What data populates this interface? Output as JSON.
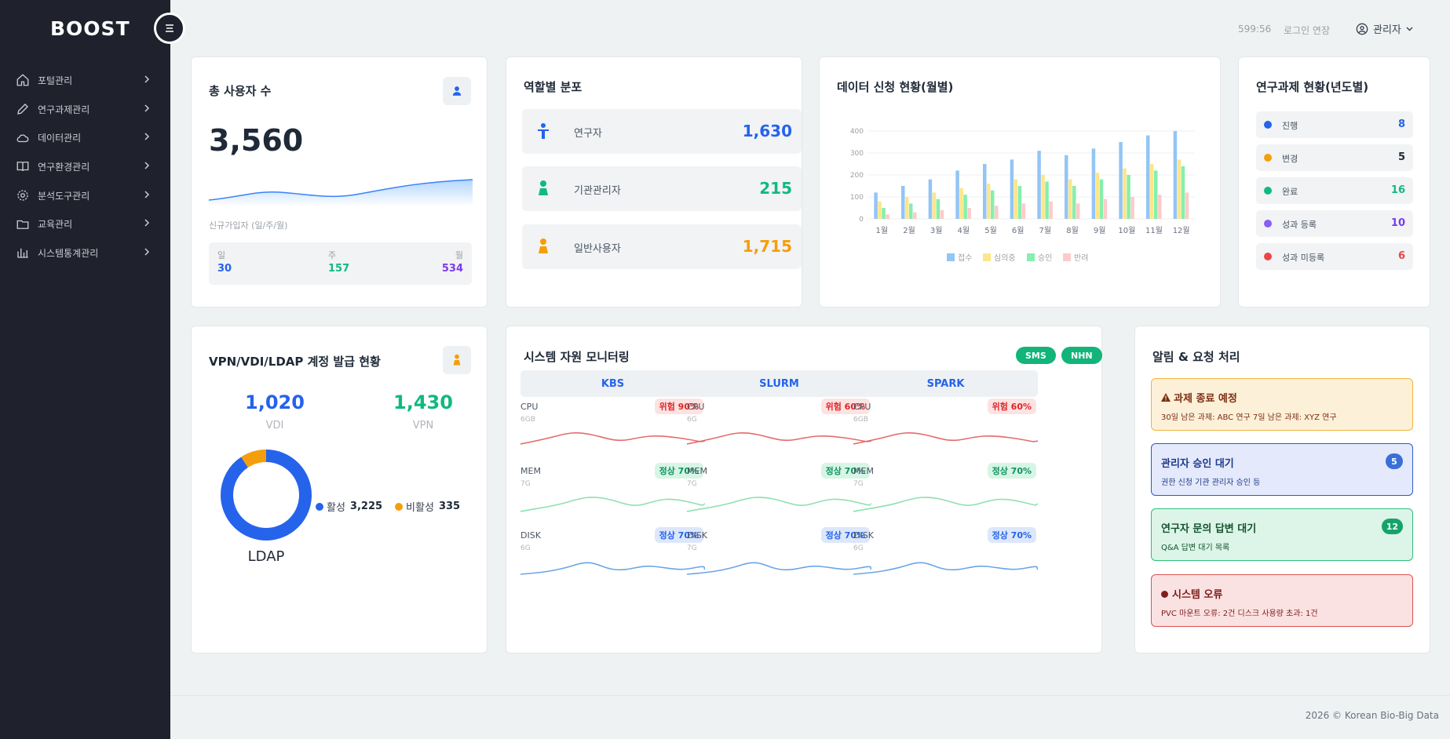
{
  "brand": {
    "logo": "BOOST"
  },
  "sidebar": {
    "items": [
      {
        "label": "포털관리",
        "icon": "home-icon"
      },
      {
        "label": "연구과제관리",
        "icon": "pencil-icon"
      },
      {
        "label": "데이터관리",
        "icon": "cloud-icon"
      },
      {
        "label": "연구환경관리",
        "icon": "book-icon"
      },
      {
        "label": "분석도구관리",
        "icon": "gear-icon"
      },
      {
        "label": "교육관리",
        "icon": "folder-icon"
      },
      {
        "label": "시스템통계관리",
        "icon": "bar-chart-icon"
      }
    ]
  },
  "header": {
    "timer": "599:56",
    "extend_label": "로그인 연장",
    "user_label": "관리자"
  },
  "total_users": {
    "title": "총 사용자 수",
    "value": "3,560",
    "caption": "신규가입자 (일/주/월)",
    "periods": [
      {
        "label": "일",
        "value": "30",
        "color": "#2563eb"
      },
      {
        "label": "주",
        "value": "157",
        "color": "#10b981"
      },
      {
        "label": "월",
        "value": "534",
        "color": "#7c3aed"
      }
    ]
  },
  "role_distribution": {
    "title": "역할별 분포",
    "rows": [
      {
        "label": "연구자",
        "value": "1,630",
        "color": "#2563eb",
        "icon": "researcher-icon"
      },
      {
        "label": "기관관리자",
        "value": "215",
        "color": "#10b981",
        "icon": "manager-icon"
      },
      {
        "label": "일반사용자",
        "value": "1,715",
        "color": "#f59e0b",
        "icon": "user-icon"
      }
    ]
  },
  "data_requests": {
    "title": "데이터 신청 현황(월별)",
    "chart_data": {
      "type": "bar",
      "categories": [
        "1월",
        "2월",
        "3월",
        "4월",
        "5월",
        "6월",
        "7월",
        "8월",
        "9월",
        "10월",
        "11월",
        "12월"
      ],
      "ylim": [
        0,
        400
      ],
      "yticks": [
        "0",
        "100",
        "200",
        "300",
        "400"
      ],
      "series": [
        {
          "name": "접수",
          "color": "#93c5f5",
          "values": [
            120,
            150,
            180,
            220,
            250,
            270,
            310,
            290,
            320,
            350,
            380,
            400
          ]
        },
        {
          "name": "심의중",
          "color": "#fde68a",
          "values": [
            80,
            100,
            120,
            140,
            160,
            180,
            200,
            180,
            210,
            230,
            250,
            270
          ]
        },
        {
          "name": "승인",
          "color": "#86efac",
          "values": [
            50,
            70,
            90,
            110,
            130,
            150,
            170,
            150,
            180,
            200,
            220,
            240
          ]
        },
        {
          "name": "반려",
          "color": "#fecaca",
          "values": [
            20,
            30,
            40,
            50,
            60,
            70,
            80,
            70,
            90,
            100,
            110,
            120
          ]
        }
      ]
    }
  },
  "projects_yearly": {
    "title": "연구과제 현황(년도별)",
    "rows": [
      {
        "label": "진행",
        "count": "8",
        "color": "#2563eb"
      },
      {
        "label": "변경",
        "count": "5",
        "color": "#f59e0b"
      },
      {
        "label": "완료",
        "count": "16",
        "color": "#10b981"
      },
      {
        "label": "성과 등록",
        "count": "10",
        "color": "#8b5cf6"
      },
      {
        "label": "성과 미등록",
        "count": "6",
        "color": "#ef4444"
      }
    ]
  },
  "accounts": {
    "title": "VPN/VDI/LDAP 계정 발급 현황",
    "vdi_value": "1,020",
    "vdi_label": "VDI",
    "vpn_value": "1,430",
    "vpn_label": "VPN",
    "ldap_label": "LDAP",
    "chart_data": {
      "type": "pie",
      "slices": [
        {
          "name": "활성",
          "value": 3225,
          "label_value": "3,225",
          "color": "#2563eb"
        },
        {
          "name": "비활성",
          "value": 335,
          "label_value": "335",
          "color": "#f59e0b"
        }
      ]
    }
  },
  "monitoring": {
    "title": "시스템 자원 모니터링",
    "pills": [
      "SMS",
      "NHN"
    ],
    "columns": [
      {
        "name": "KBS",
        "metrics": [
          {
            "label": "CPU",
            "sub": "6GB",
            "status": "위험 90%",
            "kind": "danger"
          },
          {
            "label": "MEM",
            "sub": "7G",
            "status": "정상 70%",
            "kind": "ok"
          },
          {
            "label": "DISK",
            "sub": "6G",
            "status": "정상 70%",
            "kind": "info"
          }
        ]
      },
      {
        "name": "SLURM",
        "metrics": [
          {
            "label": "CPU",
            "sub": "6G",
            "status": "위험 60%",
            "kind": "danger"
          },
          {
            "label": "MEM",
            "sub": "7G",
            "status": "정상 70%",
            "kind": "ok"
          },
          {
            "label": "DISK",
            "sub": "7G",
            "status": "정상 70%",
            "kind": "info"
          }
        ]
      },
      {
        "name": "SPARK",
        "metrics": [
          {
            "label": "CPU",
            "sub": "6GB",
            "status": "위험 60%",
            "kind": "danger"
          },
          {
            "label": "MEM",
            "sub": "7G",
            "status": "정상 70%",
            "kind": "ok"
          },
          {
            "label": "DISK",
            "sub": "6G",
            "status": "정상 70%",
            "kind": "info"
          }
        ]
      }
    ]
  },
  "alerts": {
    "title": "알림 & 요청 처리",
    "items": [
      {
        "title": "과제 종료 예정",
        "text": "30일 남은 과제: ABC 연구   7일 남은 과제: XYZ 연구",
        "count": "",
        "icon": "warning-icon"
      },
      {
        "title": "관리자 승인 대기",
        "text": "권한 신청 기관 관리자 승인 등",
        "count": "5",
        "icon": ""
      },
      {
        "title": "연구자 문의 답변 대기",
        "text": "Q&A 답변 대기 목록",
        "count": "12",
        "icon": ""
      },
      {
        "title": "시스템 오류",
        "text": "PVC 마운트 오류: 2건   디스크 사용량 초과: 1건",
        "count": "",
        "icon": "error-dot-icon"
      }
    ]
  },
  "footer": {
    "text": "2026 © Korean Bio-Big Data"
  }
}
